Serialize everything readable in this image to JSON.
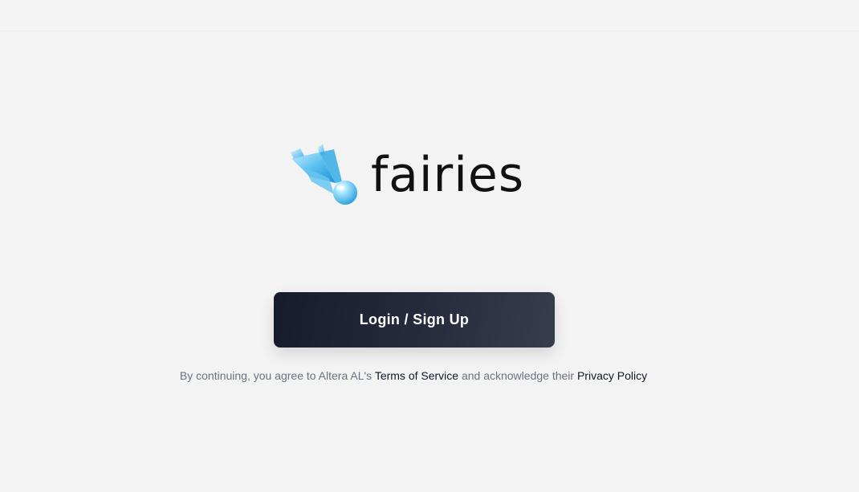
{
  "brand": {
    "name": "fairies",
    "logo_icon": "crystal-fairy-icon",
    "accent_color": "#5ec8f0"
  },
  "auth": {
    "login_label": "Login / Sign Up",
    "button_color": "#1a2030"
  },
  "legal": {
    "prefix": "By continuing, you agree to Altera AL's",
    "terms_label": "Terms of Service",
    "middle": "and acknowledge their",
    "privacy_label": "Privacy Policy"
  }
}
